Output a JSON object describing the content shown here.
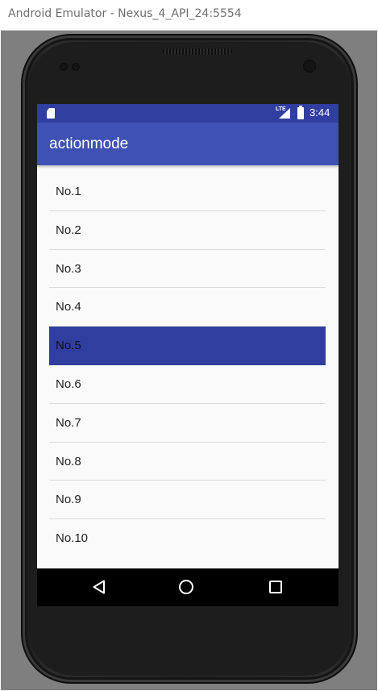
{
  "window": {
    "title": "Android Emulator - Nexus_4_API_24:5554"
  },
  "status_bar": {
    "network": "LTE",
    "time": "3:44"
  },
  "app_bar": {
    "title": "actionmode"
  },
  "list": {
    "items": [
      {
        "label": "No.1",
        "selected": false
      },
      {
        "label": "No.2",
        "selected": false
      },
      {
        "label": "No.3",
        "selected": false
      },
      {
        "label": "No.4",
        "selected": false
      },
      {
        "label": "No.5",
        "selected": true
      },
      {
        "label": "No.6",
        "selected": false
      },
      {
        "label": "No.7",
        "selected": false
      },
      {
        "label": "No.8",
        "selected": false
      },
      {
        "label": "No.9",
        "selected": false
      },
      {
        "label": "No.10",
        "selected": false
      }
    ]
  },
  "nav_bar": {
    "icons": [
      "back-icon",
      "home-icon",
      "recents-icon"
    ]
  },
  "colors": {
    "status_bar": "#303f9f",
    "app_bar": "#3f51b5",
    "selected_row": "#303f9f",
    "list_background": "#fafafa",
    "emulator_backdrop": "#7f7f7f"
  }
}
